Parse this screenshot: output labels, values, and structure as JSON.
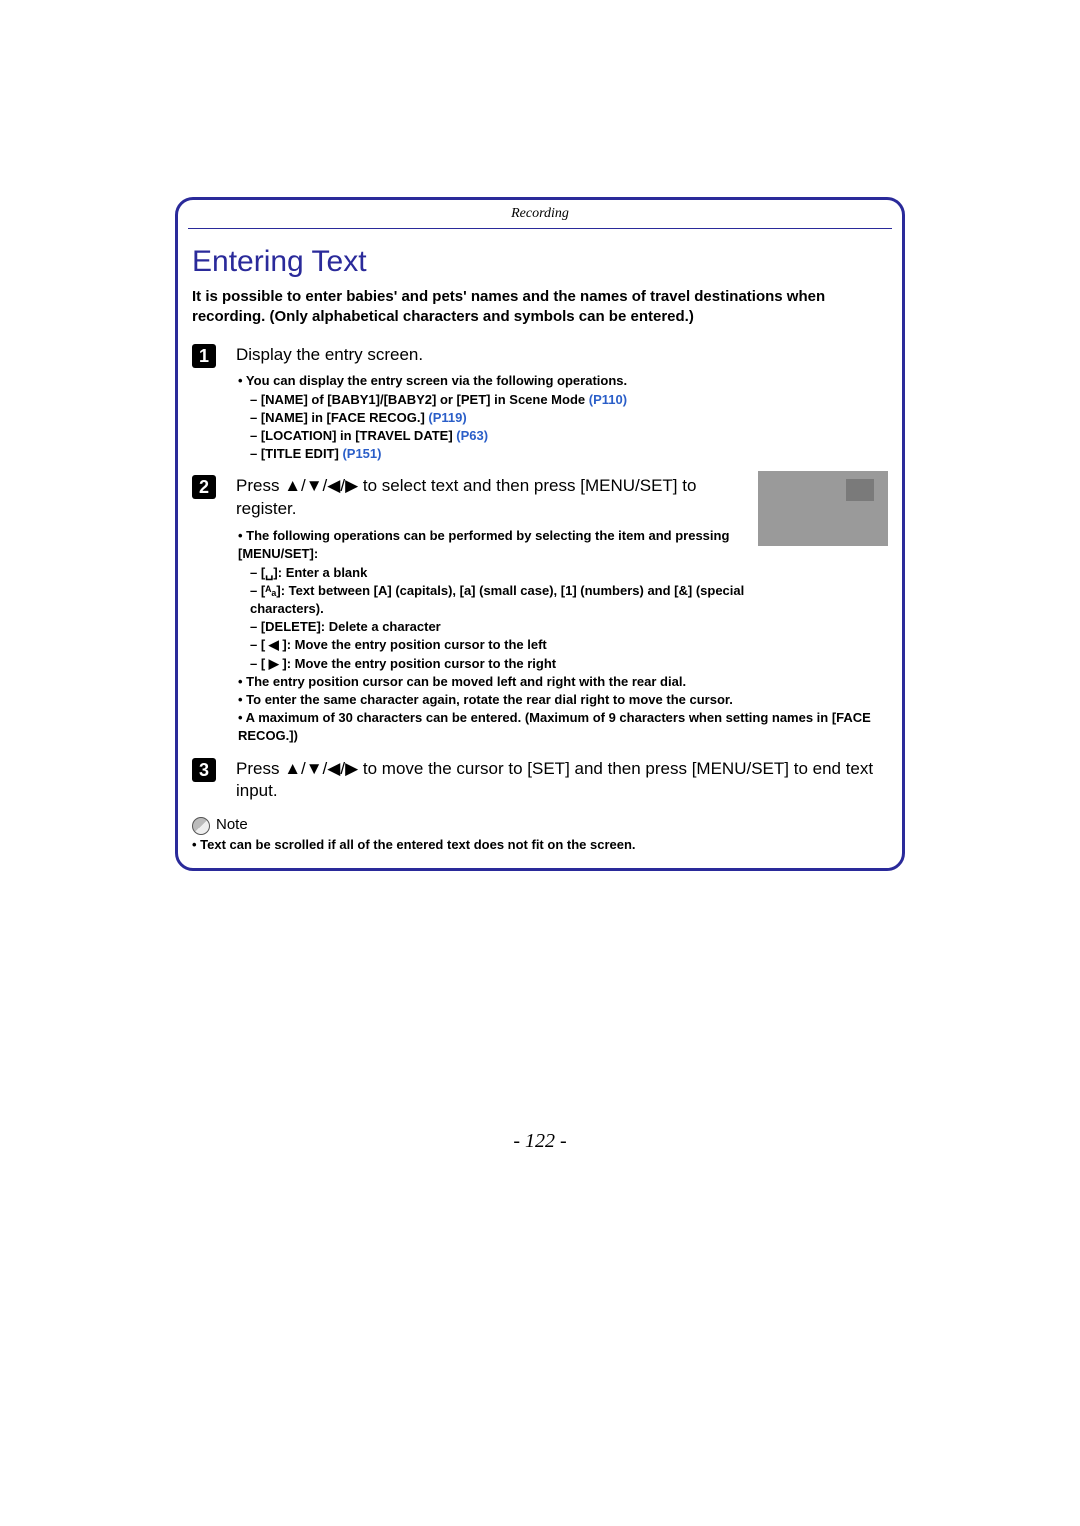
{
  "header": {
    "section": "Recording"
  },
  "title": "Entering Text",
  "intro": "It is possible to enter babies' and pets' names and the names of travel destinations when recording. (Only alphabetical characters and symbols can be entered.)",
  "steps": {
    "s1": {
      "num": "1",
      "title": "Display the entry screen.",
      "b1": "• You can display the entry screen via the following operations.",
      "b2a": "– [NAME] of [BABY1]/[BABY2] or [PET] in Scene Mode",
      "b2a_link": " (P110)",
      "b2b": "– [NAME] in [FACE RECOG.]",
      "b2b_link": " (P119)",
      "b2c": "– [LOCATION] in [TRAVEL DATE]",
      "b2c_link": " (P63)",
      "b2d": "– [TITLE EDIT]",
      "b2d_link": " (P151)"
    },
    "s2": {
      "num": "2",
      "title_a": "Press ",
      "title_arrows": "▲/▼/◀/▶",
      "title_b": " to select text and then press [MENU/SET] to register.",
      "b1": "• The following operations can be performed by selecting the item and pressing [MENU/SET]:",
      "s1": "– [␣]: Enter a blank",
      "s2": "– [ᴬₐ]: Text between [A] (capitals), [a] (small case), [1] (numbers) and [&] (special characters).",
      "s3": "– [DELETE]: Delete a character",
      "s4": "– [ ◀ ]: Move the entry position cursor to the left",
      "s5": "– [ ▶ ]: Move the entry position cursor to the right",
      "b2": "• The entry position cursor can be moved left and right with the rear dial.",
      "b3": "• To enter the same character again, rotate the rear dial right to move the cursor.",
      "b4a": "• A maximum of 30 characters can be entered. ",
      "b4b": "(Maximum of 9 characters when setting names in [FACE RECOG.])"
    },
    "s3": {
      "num": "3",
      "title_a": "Press ",
      "title_arrows": "▲/▼/◀/▶",
      "title_b": " to move the cursor to [SET] and then press [MENU/SET] to end text input."
    }
  },
  "note": {
    "label": "Note",
    "text": "• Text can be scrolled if all of the entered text does not fit on the screen."
  },
  "page_number": "- 122 -"
}
